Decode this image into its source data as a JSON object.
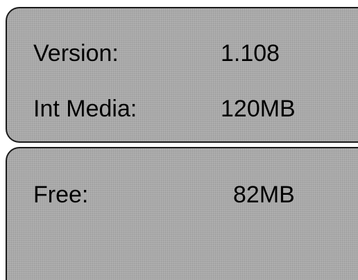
{
  "info_panel": {
    "version": {
      "label": "Version:",
      "value": "1.108"
    },
    "int_media": {
      "label": "Int Media:",
      "value": "120MB"
    }
  },
  "storage_panel": {
    "free": {
      "label": "Free:",
      "value": "82MB"
    }
  },
  "colors": {
    "panel_background": "#a9a9a9",
    "panel_border": "#1a1a1a",
    "text": "#000000"
  }
}
